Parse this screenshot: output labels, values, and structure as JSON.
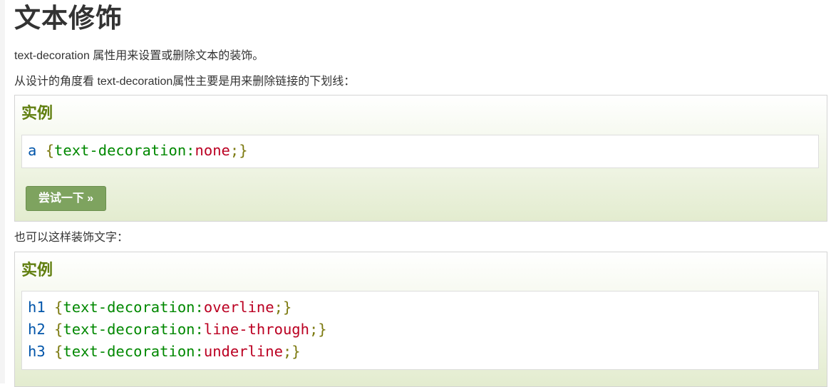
{
  "page": {
    "title": "文本修饰",
    "intro1": "text-decoration 属性用来设置或删除文本的装饰。",
    "intro2": "从设计的角度看 text-decoration属性主要是用来删除链接的下划线：",
    "intro3": "也可以这样装饰文字："
  },
  "example1": {
    "heading": "实例",
    "lines": [
      {
        "selector": "a",
        "open": "{",
        "property": "text-decoration:",
        "value": "none",
        "close": ";}"
      }
    ],
    "try_button": "尝试一下 »"
  },
  "example2": {
    "heading": "实例",
    "lines": [
      {
        "selector": "h1",
        "open": "{",
        "property": "text-decoration:",
        "value": "overline",
        "close": ";}"
      },
      {
        "selector": "h2",
        "open": "{",
        "property": "text-decoration:",
        "value": "line-through",
        "close": ";}"
      },
      {
        "selector": "h3",
        "open": "{",
        "property": "text-decoration:",
        "value": "underline",
        "close": ";}"
      }
    ]
  },
  "colors": {
    "heading_green": "#617f10",
    "button_green": "#7ea35f",
    "selector_blue": "#0055aa",
    "property_green": "#008800",
    "value_red": "#bb0022"
  }
}
